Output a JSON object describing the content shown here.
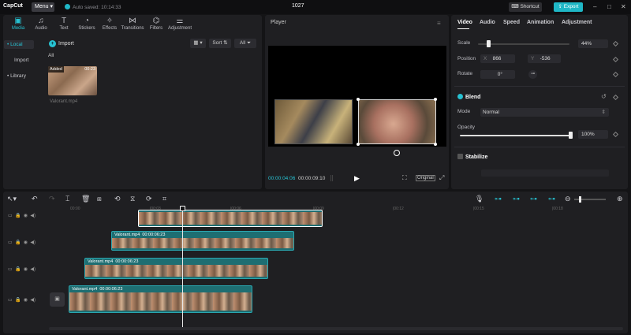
{
  "titlebar": {
    "logo": "CapCut",
    "menu": "Menu",
    "autosave": "Auto saved: 10:14:33",
    "project": "1027",
    "shortcut": "Shortcut",
    "export": "Export"
  },
  "toolbar": [
    {
      "label": "Media",
      "icon": "media-icon",
      "active": true
    },
    {
      "label": "Audio",
      "icon": "audio-icon"
    },
    {
      "label": "Text",
      "icon": "text-icon"
    },
    {
      "label": "Stickers",
      "icon": "stickers-icon"
    },
    {
      "label": "Effects",
      "icon": "effects-icon"
    },
    {
      "label": "Transitions",
      "icon": "transitions-icon"
    },
    {
      "label": "Filters",
      "icon": "filters-icon"
    },
    {
      "label": "Adjustment",
      "icon": "adjustment-icon"
    }
  ],
  "sidebar": {
    "local": "• Local",
    "import": "Import",
    "library": "• Library"
  },
  "media": {
    "import": "Import",
    "sort": "Sort",
    "all_filter": "All",
    "all_label": "All",
    "added": "Added",
    "duration": "00:23",
    "filename": "Valorant.mp4"
  },
  "player": {
    "title": "Player",
    "current": "00:00:04:06",
    "total": "00:00:09:10",
    "original": "Original"
  },
  "props": {
    "tabs": [
      "Video",
      "Audio",
      "Speed",
      "Animation",
      "Adjustment"
    ],
    "scale_label": "Scale",
    "scale_value": "44%",
    "scale_fraction": 0.44,
    "position_label": "Position",
    "pos_x_label": "X",
    "pos_x": "866",
    "pos_y_label": "Y",
    "pos_y": "-536",
    "rotate_label": "Rotate",
    "rotate_value": "0°",
    "blend": "Blend",
    "mode_label": "Mode",
    "mode_value": "Normal",
    "opacity_label": "Opacity",
    "opacity_value": "100%",
    "opacity_fraction": 1.0,
    "stabilize": "Stabilize"
  },
  "timeline": {
    "ruler": [
      "00:00",
      "|00:03",
      "|00:06",
      "|00:09",
      "|00:12",
      "|00:15",
      "|00:18"
    ],
    "clips": [
      {
        "name": "",
        "time": "",
        "selected": true
      },
      {
        "name": "Valorant.mp4",
        "time": "00:00:06:23"
      },
      {
        "name": "Valorant.mp4",
        "time": "00:00:06:23"
      },
      {
        "name": "Valorant.mp4",
        "time": "00:00:06:23"
      }
    ]
  }
}
